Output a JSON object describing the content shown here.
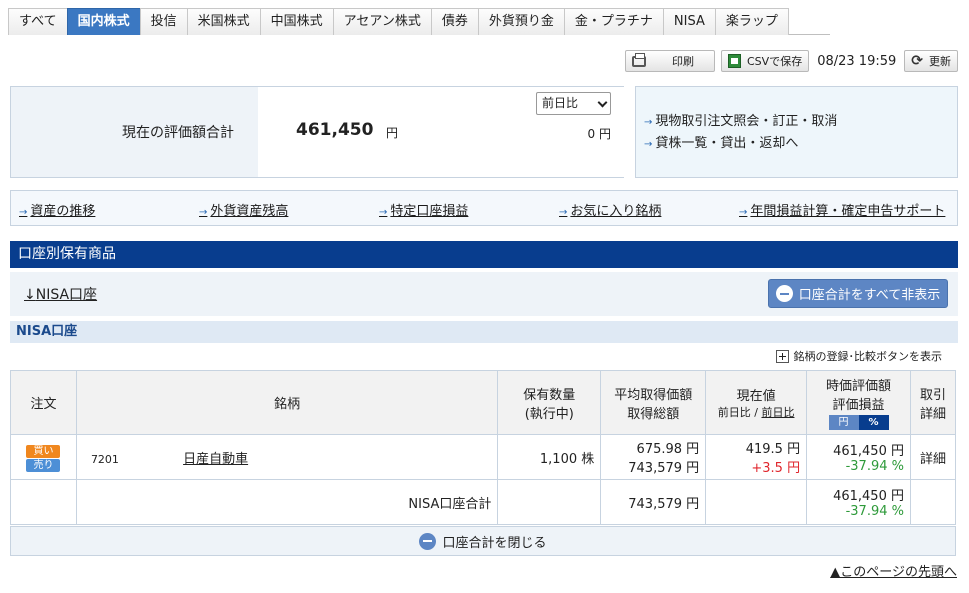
{
  "tabs": [
    "すべて",
    "国内株式",
    "投信",
    "米国株式",
    "中国株式",
    "アセアン株式",
    "債券",
    "外貨預り金",
    "金・プラチナ",
    "NISA",
    "楽ラップ"
  ],
  "active_tab": "国内株式",
  "toolbar": {
    "print_label": "印刷",
    "csv_label": "CSVで保存",
    "datetime": "08/23 19:59",
    "refresh_label": "更新"
  },
  "summary": {
    "label": "現在の評価額合計",
    "value": "461,450",
    "unit": "円",
    "compare_select": "前日比",
    "diff": "0 円"
  },
  "side_links": [
    "現物取引注文照会・訂正・取消",
    "貸株一覧・貸出・返却へ"
  ],
  "link_bar": [
    "資産の推移",
    "外貨資産残高",
    "特定口座損益",
    "お気に入り銘柄",
    "年間損益計算・確定申告サポート"
  ],
  "section_title": "口座別保有商品",
  "account_link": "NISA口座",
  "account_arrow": "↓",
  "hide_all_label": "口座合計をすべて非表示",
  "subheading": "NISA口座",
  "register_compare_label": "銘柄の登録･比較ボタンを表示",
  "table": {
    "headers": {
      "order": "注文",
      "name": "銘柄",
      "qty1": "保有数量",
      "qty2": "(執行中)",
      "avg1": "平均取得価額",
      "avg2": "取得総額",
      "cur1": "現在値",
      "cur2a": "前日比",
      "cur2sep": " / ",
      "cur2b": "前日比",
      "val1": "時価評価額",
      "val2": "評価損益",
      "toggle_yen": "円",
      "toggle_pct": "%",
      "detail1": "取引",
      "detail2": "詳細"
    },
    "row": {
      "buy": "買い",
      "sell": "売り",
      "code": "7201",
      "name": "日産自動車",
      "qty": "1,100 株",
      "avg_price": "675.98 円",
      "total_cost": "743,579 円",
      "current": "419.5 円",
      "change": "+3.5 円",
      "value": "461,450 円",
      "pl": "-37.94 %",
      "detail": "詳細"
    },
    "total": {
      "label": "NISA口座合計",
      "total_cost": "743,579 円",
      "value": "461,450 円",
      "pl": "-37.94 %"
    }
  },
  "close_label": "口座合計を閉じる",
  "page_top_label": "▲このページの先頭へ",
  "colors": {
    "active_tab": "#3b78c2",
    "section_header": "#083d8e",
    "negative": "#2e9a3a",
    "positive": "#e0262d"
  }
}
